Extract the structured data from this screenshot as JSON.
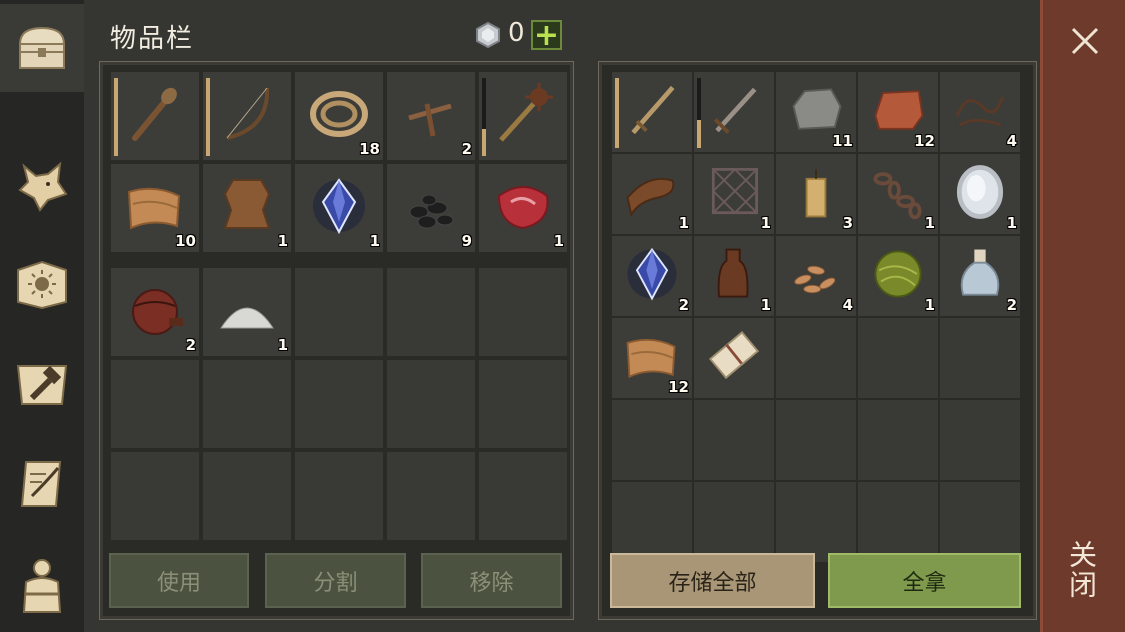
{
  "header": {
    "title": "物品栏",
    "gem_count": "0",
    "plus_label": "+"
  },
  "tabs": [
    {
      "name": "inventory",
      "icon": "chest-icon",
      "active": true
    },
    {
      "name": "pets",
      "icon": "wolf-head-icon",
      "active": false
    },
    {
      "name": "skills",
      "icon": "sun-book-icon",
      "active": false
    },
    {
      "name": "crafting",
      "icon": "hammer-map-icon",
      "active": false
    },
    {
      "name": "quests",
      "icon": "scroll-quill-icon",
      "active": false
    },
    {
      "name": "character",
      "icon": "character-backpack-icon",
      "active": false
    }
  ],
  "inventory": {
    "main_slots": [
      {
        "icon": "wooden-club-icon",
        "count": "",
        "durability": 1.0
      },
      {
        "icon": "bow-icon",
        "count": "",
        "durability": 1.0
      },
      {
        "icon": "rope-icon",
        "count": "18"
      },
      {
        "icon": "nails-icon",
        "count": "2"
      },
      {
        "icon": "spiked-mace-icon",
        "count": "",
        "durability": 0.35
      },
      {
        "icon": "cloth-icon",
        "count": "10"
      },
      {
        "icon": "leather-hide-icon",
        "count": "1"
      },
      {
        "icon": "crystal-icon",
        "count": "1"
      },
      {
        "icon": "coal-icon",
        "count": "9"
      },
      {
        "icon": "raw-meat-icon",
        "count": "1"
      }
    ],
    "bag_slots": [
      {
        "icon": "waterskin-icon",
        "count": "2"
      },
      {
        "icon": "salt-pile-icon",
        "count": "1"
      },
      {},
      {},
      {},
      {},
      {},
      {},
      {},
      {},
      {},
      {},
      {},
      {},
      {}
    ]
  },
  "storage": {
    "slots": [
      {
        "icon": "wooden-sword-icon",
        "count": "",
        "durability": 1.0
      },
      {
        "icon": "sword-icon",
        "count": "",
        "durability": 0.4
      },
      {
        "icon": "stone-icon",
        "count": "11"
      },
      {
        "icon": "copper-ingot-icon",
        "count": "12"
      },
      {
        "icon": "wire-icon",
        "count": "4"
      },
      {
        "icon": "leather-strip-icon",
        "count": "1"
      },
      {
        "icon": "metal-grate-icon",
        "count": "1"
      },
      {
        "icon": "candle-icon",
        "count": "3"
      },
      {
        "icon": "chain-icon",
        "count": "1"
      },
      {
        "icon": "mirror-icon",
        "count": "1"
      },
      {
        "icon": "crystal-icon",
        "count": "2"
      },
      {
        "icon": "bottle-icon",
        "count": "1"
      },
      {
        "icon": "seeds-icon",
        "count": "4"
      },
      {
        "icon": "yarn-ball-icon",
        "count": "1"
      },
      {
        "icon": "potion-flask-icon",
        "count": "2"
      },
      {
        "icon": "cloth-icon",
        "count": "12"
      },
      {
        "icon": "paper-scroll-icon",
        "count": ""
      },
      {},
      {},
      {},
      {},
      {},
      {},
      {},
      {},
      {},
      {},
      {},
      {},
      {}
    ]
  },
  "buttons": {
    "use": "使用",
    "split": "分割",
    "remove": "移除",
    "store_all": "存储全部",
    "take_all": "全拿",
    "close": "关闭"
  },
  "colors": {
    "accent_green": "#7f9a4d",
    "close_red": "#6e3a2c",
    "durability_tan": "#c9a772"
  }
}
